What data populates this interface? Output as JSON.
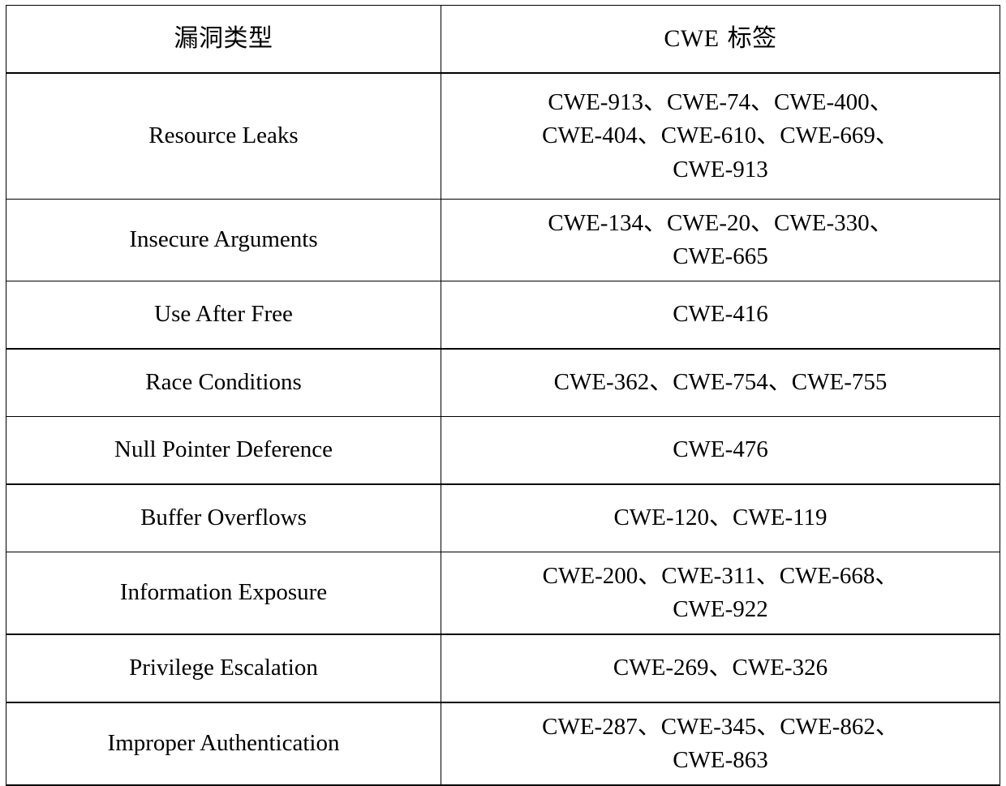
{
  "table": {
    "headers": {
      "type": "漏洞类型",
      "label": "CWE 标签"
    },
    "rows": [
      {
        "type": "Resource Leaks",
        "label": "CWE-913、CWE-74、CWE-400、CWE-404、CWE-610、CWE-669、CWE-913",
        "lines": [
          "CWE-913、CWE-74、CWE-400、",
          "CWE-404、CWE-610、CWE-669、",
          "CWE-913"
        ]
      },
      {
        "type": "Insecure Arguments",
        "label": "CWE-134、CWE-20、CWE-330、CWE-665",
        "lines": [
          "CWE-134、CWE-20、CWE-330、",
          "CWE-665"
        ]
      },
      {
        "type": "Use After Free",
        "label": "CWE-416",
        "lines": [
          "CWE-416"
        ]
      },
      {
        "type": "Race Conditions",
        "label": "CWE-362、CWE-754、CWE-755",
        "lines": [
          "CWE-362、CWE-754、CWE-755"
        ]
      },
      {
        "type": "Null Pointer Deference",
        "label": "CWE-476",
        "lines": [
          "CWE-476"
        ]
      },
      {
        "type": "Buffer Overflows",
        "label": "CWE-120、CWE-119",
        "lines": [
          "CWE-120、CWE-119"
        ]
      },
      {
        "type": "Information Exposure",
        "label": "CWE-200、CWE-311、CWE-668、CWE-922",
        "lines": [
          "CWE-200、CWE-311、CWE-668、",
          "CWE-922"
        ]
      },
      {
        "type": "Privilege Escalation",
        "label": "CWE-269、CWE-326",
        "lines": [
          "CWE-269、CWE-326"
        ]
      },
      {
        "type": "Improper Authentication",
        "label": "CWE-287、CWE-345、CWE-862、CWE-863",
        "lines": [
          "CWE-287、CWE-345、CWE-862、",
          "CWE-863"
        ]
      }
    ]
  },
  "colors": {
    "border": "#000000",
    "text": "#000000",
    "background": "#ffffff"
  }
}
